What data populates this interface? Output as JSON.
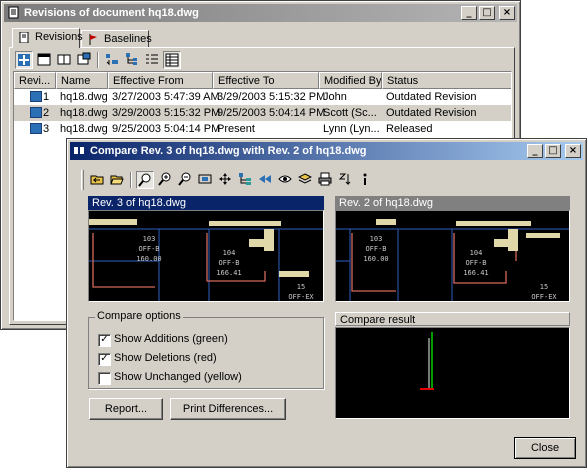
{
  "back_window": {
    "title": "Revisions of document hq18.dwg",
    "tabs": [
      {
        "label": "Revisions"
      },
      {
        "label": "Baselines"
      }
    ],
    "columns": [
      "Revi...",
      "Name",
      "Effective From",
      "Effective To",
      "Modified By",
      "Status"
    ],
    "rows": [
      {
        "rev": "1",
        "name": "hq18.dwg",
        "from": "3/27/2003 5:47:39 AM",
        "to": "3/29/2003 5:15:32 PM",
        "by": "John",
        "status": "Outdated Revision"
      },
      {
        "rev": "2",
        "name": "hq18.dwg",
        "from": "3/29/2003 5:15:32 PM",
        "to": "9/25/2003 5:04:14 PM",
        "by": "Scott (Sc...",
        "status": "Outdated Revision"
      },
      {
        "rev": "3",
        "name": "hq18.dwg",
        "from": "9/25/2003 5:04:14 PM",
        "to": "Present",
        "by": "Lynn (Lyn...",
        "status": "Released"
      }
    ]
  },
  "compare_window": {
    "title": "Compare Rev. 3 of hq18.dwg with Rev. 2 of hq18.dwg",
    "left_pane_title": "Rev. 3 of hq18.dwg",
    "right_pane_title": "Rev. 2 of hq18.dwg",
    "drawing_labels": {
      "room_a": "103",
      "room_a_sub": "OFF-B",
      "room_a_area": "160.00",
      "room_b": "104",
      "room_b_sub": "OFF-B",
      "room_b_area": "166.41",
      "room_c": "15",
      "room_c_sub": "OFF-EX"
    },
    "compare_options": {
      "legend": "Compare options",
      "options": [
        {
          "label": "Show Additions (green)",
          "checked": true
        },
        {
          "label": "Show Deletions (red)",
          "checked": true
        },
        {
          "label": "Show Unchanged (yellow)",
          "checked": false
        }
      ]
    },
    "result_title": "Compare result",
    "buttons": {
      "report": "Report...",
      "print": "Print Differences...",
      "close": "Close"
    }
  },
  "colors": {
    "active_title": "#0a246a",
    "inactive_title": "#808080",
    "face": "#d4d0c8",
    "addition": "#00d000",
    "deletion": "#e00000",
    "drawing_bg": "#000000"
  }
}
